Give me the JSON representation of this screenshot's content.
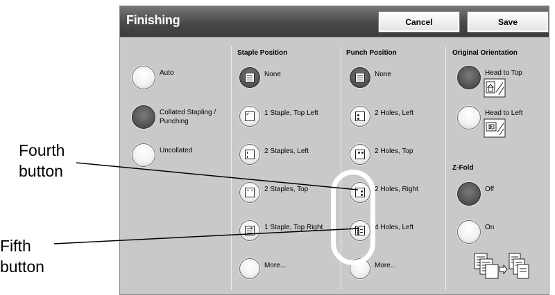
{
  "callouts": {
    "fourth": [
      "Fourth",
      "button"
    ],
    "fifth": [
      "Fifth",
      "button"
    ]
  },
  "window": {
    "title": "Finishing"
  },
  "toolbar": {
    "cancel_label": "Cancel",
    "save_label": "Save"
  },
  "finishing_options": [
    {
      "label": "Auto",
      "selected": false
    },
    {
      "label": "Collated Stapling / Punching",
      "selected": true
    },
    {
      "label": "Uncollated",
      "selected": false
    }
  ],
  "staple_position": {
    "heading": "Staple Position",
    "items": [
      {
        "label": "None",
        "icon": "none-icon",
        "selected": true
      },
      {
        "label": "1 Staple, Top Left",
        "icon": "staple-top-left-icon",
        "selected": false
      },
      {
        "label": "2 Staples, Left",
        "icon": "staples-left-icon",
        "selected": false
      },
      {
        "label": "2 Staples, Top",
        "icon": "staples-top-icon",
        "selected": false
      },
      {
        "label": "1 Staple, Top Right",
        "icon": "staple-top-right-icon",
        "selected": false
      },
      {
        "label": "More...",
        "icon": "",
        "selected": false
      }
    ]
  },
  "punch_position": {
    "heading": "Punch Position",
    "items": [
      {
        "label": "None",
        "icon": "none-icon",
        "selected": true
      },
      {
        "label": "2 Holes, Left",
        "icon": "holes-left-icon",
        "selected": false
      },
      {
        "label": "2 Holes, Top",
        "icon": "holes-top-icon",
        "selected": false
      },
      {
        "label": "2 Holes, Right",
        "icon": "holes-right-icon",
        "selected": false
      },
      {
        "label": "4 Holes, Left",
        "icon": "four-holes-left-icon",
        "selected": false
      },
      {
        "label": "More...",
        "icon": "",
        "selected": false
      }
    ]
  },
  "original_orientation": {
    "heading": "Original Orientation",
    "items": [
      {
        "label": "Head to Top",
        "selected": true
      },
      {
        "label": "Head to Left",
        "selected": false
      }
    ]
  },
  "z_fold": {
    "heading": "Z-Fold",
    "items": [
      {
        "label": "Off",
        "selected": true
      },
      {
        "label": "On",
        "selected": false
      }
    ]
  }
}
